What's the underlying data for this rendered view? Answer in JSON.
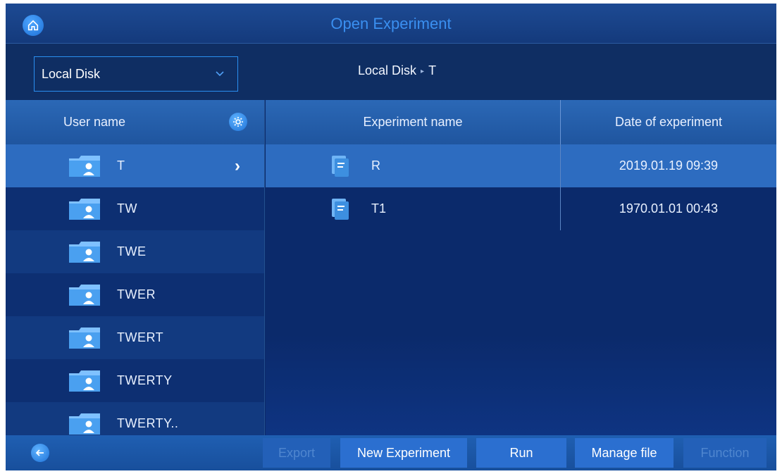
{
  "header": {
    "title": "Open Experiment"
  },
  "source": {
    "selected": "Local Disk",
    "path_root": "Local Disk",
    "path_leaf": "T",
    "path_sep": "▸"
  },
  "users": {
    "column_label": "User name",
    "items": [
      {
        "name": "T",
        "selected": true
      },
      {
        "name": "TW"
      },
      {
        "name": "TWE"
      },
      {
        "name": "TWER"
      },
      {
        "name": "TWERT"
      },
      {
        "name": "TWERTY"
      },
      {
        "name": "TWERTY.."
      }
    ],
    "chevron": "›"
  },
  "experiments": {
    "col_name": "Experiment name",
    "col_date": "Date of experiment",
    "rows": [
      {
        "name": "R",
        "date": "2019.01.19 09:39",
        "selected": true
      },
      {
        "name": "T1",
        "date": "1970.01.01 00:43"
      }
    ]
  },
  "footer": {
    "buttons": {
      "export": "Export",
      "new_experiment": "New Experiment",
      "run": "Run",
      "manage_file": "Manage file",
      "function": "Function"
    }
  },
  "icons": {
    "home": "home-icon",
    "settings": "user-settings-icon",
    "back": "back-arrow-icon",
    "folder": "user-folder-icon",
    "document": "experiment-file-icon",
    "dropdown": "chevron-down-icon"
  },
  "colors": {
    "accent": "#2a8ff0",
    "selected_row": "#2d6cc0",
    "title": "#3a8ff0",
    "disabled_text": "#4f86cf"
  }
}
